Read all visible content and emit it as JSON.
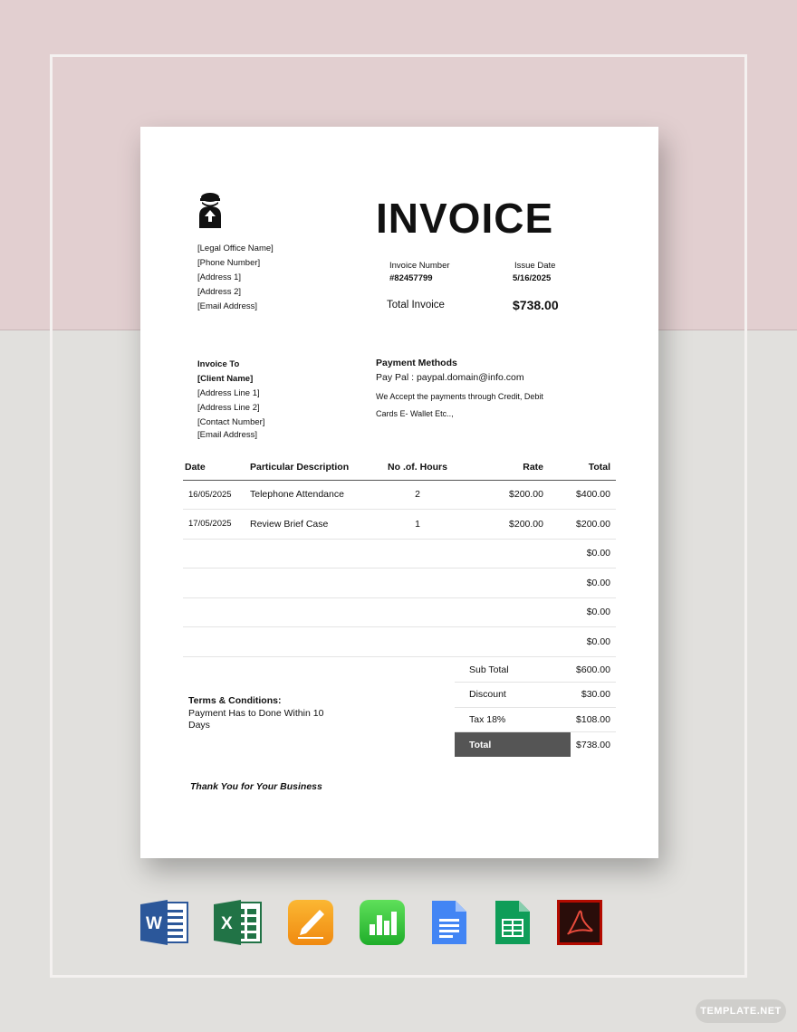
{
  "brand_colors": {
    "top_bg": "#e2cfd0",
    "bottom_bg": "#e1e0dd",
    "total_bar": "#555555"
  },
  "logo_icon": "lawyer-icon",
  "office": {
    "lines": [
      "[Legal Office Name]",
      "[Phone Number]",
      "[Address 1]",
      "[Address 2]",
      "[Email Address]"
    ]
  },
  "invoice": {
    "title": "INVOICE",
    "number_label": "Invoice Number",
    "number_value": "#82457799",
    "date_label": "Issue Date",
    "date_value": "5/16/2025",
    "total_label": "Total Invoice",
    "total_value": "$738.00"
  },
  "bill_to": {
    "title": "Invoice To",
    "client": "[Client Name]",
    "lines": [
      "[Address Line 1]",
      "[Address Line 2]",
      "[Contact Number]",
      "[Email Address]"
    ]
  },
  "payment": {
    "title": "Payment Methods",
    "paypal": "Pay Pal : paypal.domain@info.com",
    "desc_line1": "We Accept the payments through Credit, Debit",
    "desc_line2": "Cards E- Wallet Etc..,"
  },
  "items": {
    "headers": {
      "date": "Date",
      "desc": "Particular Description",
      "hours": "No .of. Hours",
      "rate": "Rate",
      "total": "Total"
    },
    "rows": [
      {
        "date": "16/05/2025",
        "desc": "Telephone Attendance",
        "hours": "2",
        "rate": "$200.00",
        "total": "$400.00"
      },
      {
        "date": "17/05/2025",
        "desc": "Review Brief Case",
        "hours": "1",
        "rate": "$200.00",
        "total": "$200.00"
      },
      {
        "date": "",
        "desc": "",
        "hours": "",
        "rate": "",
        "total": "$0.00"
      },
      {
        "date": "",
        "desc": "",
        "hours": "",
        "rate": "",
        "total": "$0.00"
      },
      {
        "date": "",
        "desc": "",
        "hours": "",
        "rate": "",
        "total": "$0.00"
      },
      {
        "date": "",
        "desc": "",
        "hours": "",
        "rate": "",
        "total": "$0.00"
      }
    ]
  },
  "summary": {
    "subtotal_label": "Sub Total",
    "subtotal_value": "$600.00",
    "discount_label": "Discount",
    "discount_value": "$30.00",
    "tax_label": "Tax 18%",
    "tax_value": "$108.00",
    "total_label": "Total",
    "total_value": "$738.00"
  },
  "terms": {
    "title": "Terms & Conditions:",
    "body": "Payment Has to Done  Within 10 Days"
  },
  "thanks": "Thank You for Your Business",
  "apps": [
    {
      "icon": "word-icon",
      "letter": "W",
      "color": "#2b579a"
    },
    {
      "icon": "excel-icon",
      "letter": "X",
      "color": "#217346"
    },
    {
      "icon": "pages-icon",
      "color": "#f7a01c"
    },
    {
      "icon": "numbers-icon",
      "color": "#33c23b"
    },
    {
      "icon": "google-docs-icon",
      "color": "#4285f4"
    },
    {
      "icon": "google-sheets-icon",
      "color": "#0f9d58"
    },
    {
      "icon": "acrobat-icon",
      "color": "#b30b00"
    }
  ],
  "badge": "TEMPLATE.NET"
}
